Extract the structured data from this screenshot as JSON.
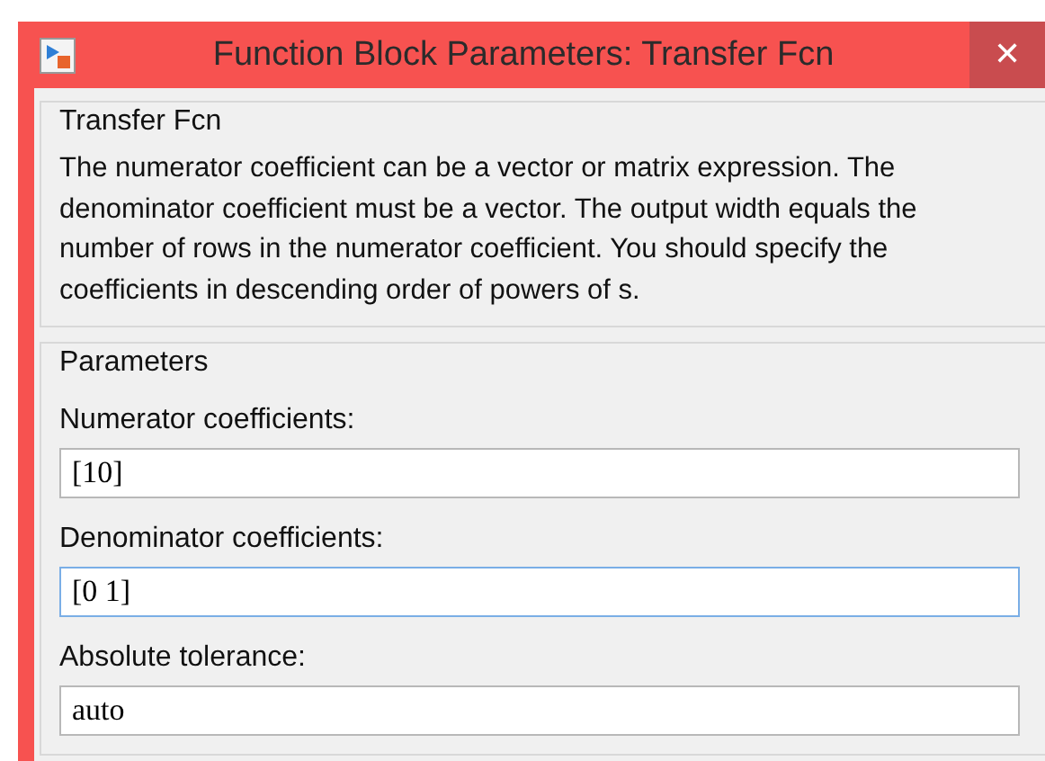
{
  "window": {
    "title": "Function Block Parameters: Transfer Fcn",
    "close": "✕"
  },
  "description": {
    "title": "Transfer Fcn",
    "text": "The numerator coefficient can be a vector or matrix expression. The denominator coefficient must be a vector. The output width equals the number of rows in the numerator coefficient. You should specify the coefficients in descending order of powers of s."
  },
  "parameters": {
    "title": "Parameters",
    "fields": [
      {
        "label": "Numerator coefficients:",
        "value": "[10]",
        "focused": false
      },
      {
        "label": "Denominator coefficients:",
        "value": "[0 1]",
        "focused": true
      },
      {
        "label": "Absolute tolerance:",
        "value": "auto",
        "focused": false
      }
    ]
  }
}
